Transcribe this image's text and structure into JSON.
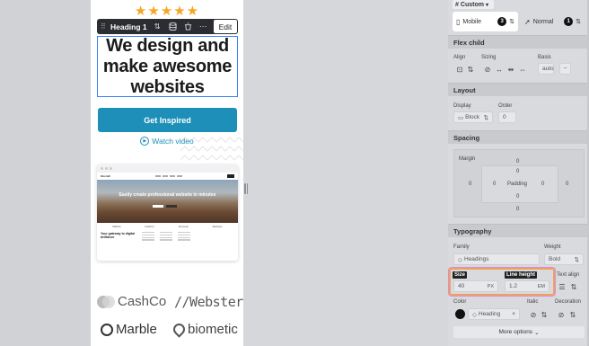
{
  "canvas": {
    "stars": "★★★★★",
    "toolbar": {
      "element_label": "Heading 1",
      "edit_label": "Edit"
    },
    "heading": "We design and make awesome websites",
    "cta_label": "Get Inspired",
    "watch_label": "Watch video",
    "mockup": {
      "brand": "Oncraft",
      "hero_text": "Easily create professional website in minutes",
      "logos": [
        "Marble",
        "CashCo",
        "biometic",
        "Webster"
      ],
      "gateway_text": "Your gateway to digital brilliance"
    },
    "logos": [
      {
        "name": "CashCo"
      },
      {
        "name": "//Webster"
      },
      {
        "name": "Marble"
      },
      {
        "name": "biometic"
      }
    ]
  },
  "panel": {
    "dropdown_label": "Custom",
    "devices": [
      {
        "label": "Mobile",
        "count": "3"
      },
      {
        "label": "Normal",
        "count": "1"
      }
    ],
    "flex_child": {
      "title": "Flex child",
      "align_label": "Align",
      "sizing_label": "Sizing",
      "basis_label": "Basis",
      "basis_placeholder": "auto"
    },
    "layout": {
      "title": "Layout",
      "display_label": "Display",
      "display_value": "Block",
      "order_label": "Order",
      "order_placeholder": "0"
    },
    "spacing": {
      "title": "Spacing",
      "margin_label": "Margin",
      "padding_label": "Padding",
      "margin_top": "0",
      "padding_top": "0",
      "margin_left": "0",
      "padding_left": "0",
      "padding_right": "0",
      "margin_right": "0",
      "padding_bottom": "0",
      "margin_bottom": "0"
    },
    "typography": {
      "title": "Typography",
      "family_label": "Family",
      "family_value": "Headings",
      "weight_label": "Weight",
      "weight_value": "Bold",
      "size_label": "Size",
      "size_value": "40",
      "size_unit": "PX",
      "line_height_label": "Line height",
      "line_height_value": "1.2",
      "line_height_unit": "EM",
      "text_align_label": "Text align",
      "color_label": "Color",
      "color_value": "Heading",
      "italic_label": "Italic",
      "decoration_label": "Decoration"
    },
    "more_options_label": "More options"
  },
  "colors": {
    "accent": "#1d8fb8",
    "selection": "#3b82f6",
    "highlight": "#f0a25a",
    "stars": "#f5a623"
  }
}
